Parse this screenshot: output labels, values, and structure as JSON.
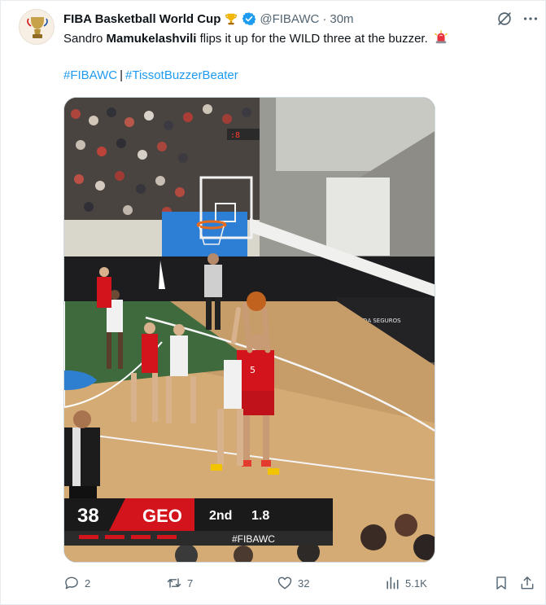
{
  "tweet": {
    "display_name": "FIBA Basketball World Cup",
    "handle": "@FIBAWC",
    "separator": "·",
    "time": "30m",
    "text_before": "Sandro ",
    "text_bold": "Mamukelashvili",
    "text_after": " flips it up for the WILD three at the buzzer.",
    "hashtags": [
      "#FIBAWC",
      "#TissotBuzzerBeater"
    ],
    "hashtag_separator": "|",
    "icons": {
      "avatar": "fiba-trophy-logo",
      "name_badge": "trophy-emoji",
      "verified": "verified-badge",
      "siren": "rotating-light-emoji",
      "grok": "grok-icon",
      "more": "more-icon"
    },
    "colors": {
      "link": "#1d9bf0",
      "verified": "#1d9bf0",
      "secondary_text": "#536471"
    }
  },
  "video": {
    "scoreboard": {
      "score": "38",
      "team": "GEO",
      "period": "2nd",
      "clock": "1.8",
      "hashtag": "#FIBAWC"
    },
    "court_brand": "REAL VIDA SEGUROS",
    "player_number": "5",
    "colors": {
      "team_red": "#d3141c",
      "scoreboard_dark": "#1a1a1a"
    }
  },
  "actions": {
    "replies": "2",
    "reposts": "7",
    "likes": "32",
    "views": "5.1K"
  }
}
